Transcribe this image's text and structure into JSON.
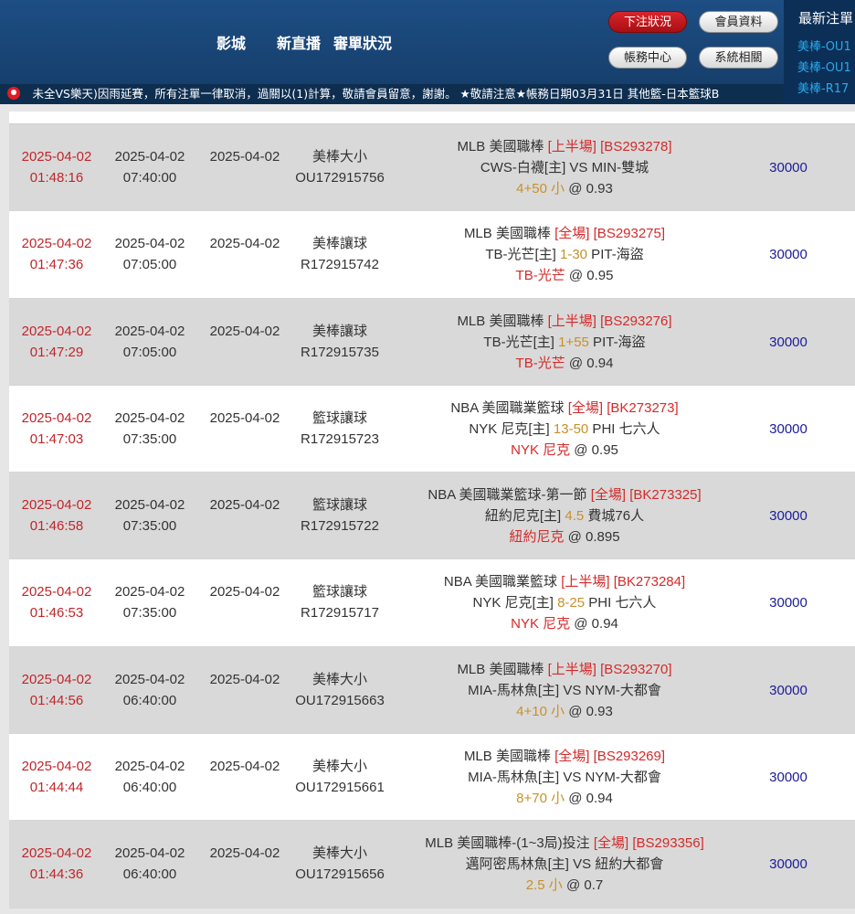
{
  "header": {
    "nav": [
      "影城",
      "新直播",
      "審單狀況"
    ],
    "buttons": {
      "bet_status": "下注狀況",
      "member_info": "會員資料",
      "account_center": "帳務中心",
      "system": "系統相關"
    },
    "latest_orders": {
      "title": "最新注單",
      "items": [
        "美棒-OU1",
        "美棒-OU1",
        "美棒-R17"
      ]
    }
  },
  "marquee": {
    "text": "ㅤ未全VS樂天)因雨延賽，所有注單一律取消，過關以(1)計算，敬請會員留意，謝謝。 ★敬請注意★帳務日期03月31日 其他籃-日本籃球B"
  },
  "rows": [
    {
      "bet_date": "2025-04-02",
      "bet_time": "01:48:16",
      "game_date": "2025-04-02",
      "game_time": "07:40:00",
      "account_date": "2025-04-02",
      "type": "美棒大小",
      "order_id": "OU172915756",
      "league": "MLB 美國職棒 ",
      "period": "[上半場]",
      "code": "[BS293278]",
      "match_a": "CWS-白襪[主] ",
      "line": "",
      "match_vs": "VS MIN-雙城",
      "pick": "4+50 小",
      "pick_color": "gold",
      "odds": " @ 0.93",
      "amount": "30000",
      "shade": "gray"
    },
    {
      "bet_date": "2025-04-02",
      "bet_time": "01:47:36",
      "game_date": "2025-04-02",
      "game_time": "07:05:00",
      "account_date": "2025-04-02",
      "type": "美棒讓球",
      "order_id": "R172915742",
      "league": "MLB 美國職棒 ",
      "period": "[全場]",
      "code": "[BS293275]",
      "match_a": "TB-光芒[主] ",
      "line": "1-30",
      "match_vs": " PIT-海盜",
      "pick": "TB-光芒",
      "pick_color": "red",
      "odds": " @ 0.95",
      "amount": "30000",
      "shade": "white"
    },
    {
      "bet_date": "2025-04-02",
      "bet_time": "01:47:29",
      "game_date": "2025-04-02",
      "game_time": "07:05:00",
      "account_date": "2025-04-02",
      "type": "美棒讓球",
      "order_id": "R172915735",
      "league": "MLB 美國職棒 ",
      "period": "[上半場]",
      "code": "[BS293276]",
      "match_a": "TB-光芒[主] ",
      "line": "1+55",
      "match_vs": " PIT-海盜",
      "pick": "TB-光芒",
      "pick_color": "red",
      "odds": " @ 0.94",
      "amount": "30000",
      "shade": "gray"
    },
    {
      "bet_date": "2025-04-02",
      "bet_time": "01:47:03",
      "game_date": "2025-04-02",
      "game_time": "07:35:00",
      "account_date": "2025-04-02",
      "type": "籃球讓球",
      "order_id": "R172915723",
      "league": "NBA 美國職業籃球 ",
      "period": "[全場]",
      "code": "[BK273273]",
      "match_a": "NYK 尼克[主] ",
      "line": "13-50",
      "match_vs": " PHI 七六人",
      "pick": "NYK 尼克",
      "pick_color": "red",
      "odds": " @ 0.95",
      "amount": "30000",
      "shade": "white"
    },
    {
      "bet_date": "2025-04-02",
      "bet_time": "01:46:58",
      "game_date": "2025-04-02",
      "game_time": "07:35:00",
      "account_date": "2025-04-02",
      "type": "籃球讓球",
      "order_id": "R172915722",
      "league": "NBA 美國職業籃球-第一節 ",
      "period": "[全場]",
      "code": "[BK273325]",
      "match_a": "紐約尼克[主] ",
      "line": "4.5",
      "match_vs": " 費城76人",
      "pick": "紐約尼克",
      "pick_color": "red",
      "odds": " @ 0.895",
      "amount": "30000",
      "shade": "gray"
    },
    {
      "bet_date": "2025-04-02",
      "bet_time": "01:46:53",
      "game_date": "2025-04-02",
      "game_time": "07:35:00",
      "account_date": "2025-04-02",
      "type": "籃球讓球",
      "order_id": "R172915717",
      "league": "NBA 美國職業籃球 ",
      "period": "[上半場]",
      "code": "[BK273284]",
      "match_a": "NYK 尼克[主] ",
      "line": "8-25",
      "match_vs": " PHI 七六人",
      "pick": "NYK 尼克",
      "pick_color": "red",
      "odds": " @ 0.94",
      "amount": "30000",
      "shade": "white"
    },
    {
      "bet_date": "2025-04-02",
      "bet_time": "01:44:56",
      "game_date": "2025-04-02",
      "game_time": "06:40:00",
      "account_date": "2025-04-02",
      "type": "美棒大小",
      "order_id": "OU172915663",
      "league": "MLB 美國職棒 ",
      "period": "[上半場]",
      "code": "[BS293270]",
      "match_a": "MIA-馬林魚[主] ",
      "line": "",
      "match_vs": "VS NYM-大都會",
      "pick": "4+10 小",
      "pick_color": "gold",
      "odds": " @ 0.93",
      "amount": "30000",
      "shade": "gray"
    },
    {
      "bet_date": "2025-04-02",
      "bet_time": "01:44:44",
      "game_date": "2025-04-02",
      "game_time": "06:40:00",
      "account_date": "2025-04-02",
      "type": "美棒大小",
      "order_id": "OU172915661",
      "league": "MLB 美國職棒 ",
      "period": "[全場]",
      "code": "[BS293269]",
      "match_a": "MIA-馬林魚[主] ",
      "line": "",
      "match_vs": "VS NYM-大都會",
      "pick": "8+70 小",
      "pick_color": "gold",
      "odds": " @ 0.94",
      "amount": "30000",
      "shade": "white"
    },
    {
      "bet_date": "2025-04-02",
      "bet_time": "01:44:36",
      "game_date": "2025-04-02",
      "game_time": "06:40:00",
      "account_date": "2025-04-02",
      "type": "美棒大小",
      "order_id": "OU172915656",
      "league": "MLB 美國職棒-(1~3局)投注 ",
      "period": "[全場]",
      "code": "[BS293356]",
      "match_a": "邁阿密馬林魚[主] ",
      "line": "",
      "match_vs": "VS 紐約大都會",
      "pick": "2.5 小",
      "pick_color": "gold",
      "odds": " @ 0.7",
      "amount": "30000",
      "shade": "gray"
    }
  ]
}
